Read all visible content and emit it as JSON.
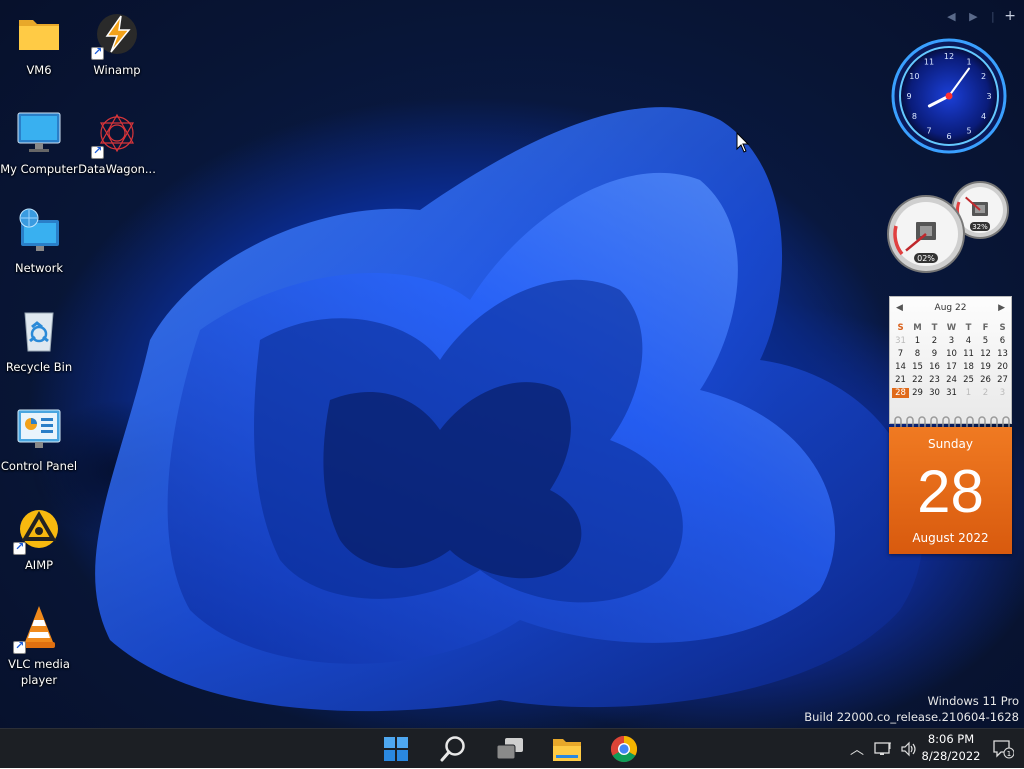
{
  "desktop_icons": [
    {
      "label": "VM6",
      "icon": "folder-icon"
    },
    {
      "label": "Winamp",
      "icon": "winamp-icon"
    },
    {
      "label": "My Computer",
      "icon": "monitor-icon"
    },
    {
      "label": "DataWagon...",
      "icon": "datawagon-icon"
    },
    {
      "label": "Network",
      "icon": "network-icon"
    },
    {
      "label": "Recycle Bin",
      "icon": "recycle-bin-icon"
    },
    {
      "label": "Control Panel",
      "icon": "control-panel-icon"
    },
    {
      "label": "AIMP",
      "icon": "aimp-icon"
    },
    {
      "label": "VLC media player",
      "icon": "vlc-icon"
    }
  ],
  "clock_gadget": {
    "numerals": [
      "12",
      "1",
      "2",
      "3",
      "4",
      "5",
      "6",
      "7",
      "8",
      "9",
      "10",
      "11"
    ],
    "time": "8:06"
  },
  "cpu_gauge": {
    "percent_label": "02%",
    "value": 2
  },
  "ram_gauge": {
    "percent_label": "32%",
    "value": 32
  },
  "calendar": {
    "month_label": "Aug 22",
    "weekday_headers": [
      "S",
      "M",
      "T",
      "W",
      "T",
      "F",
      "S"
    ],
    "weeks": [
      [
        "31",
        "1",
        "2",
        "3",
        "4",
        "5",
        "6"
      ],
      [
        "7",
        "8",
        "9",
        "10",
        "11",
        "12",
        "13"
      ],
      [
        "14",
        "15",
        "16",
        "17",
        "18",
        "19",
        "20"
      ],
      [
        "21",
        "22",
        "23",
        "24",
        "25",
        "26",
        "27"
      ],
      [
        "28",
        "29",
        "30",
        "31",
        "1",
        "2",
        "3"
      ]
    ],
    "day_name": "Sunday",
    "day_number": "28",
    "month_year": "August 2022",
    "accent": "#e8701c"
  },
  "watermark": {
    "edition": "Windows 11 Pro",
    "build": "Build 22000.co_release.210604-1628"
  },
  "taskbar": {
    "apps": [
      "start-icon",
      "search-icon",
      "task-view-icon",
      "file-explorer-icon",
      "chrome-icon"
    ],
    "time": "8:06 PM",
    "date": "8/28/2022",
    "notification_count": "1",
    "background": "#1c1f24"
  }
}
